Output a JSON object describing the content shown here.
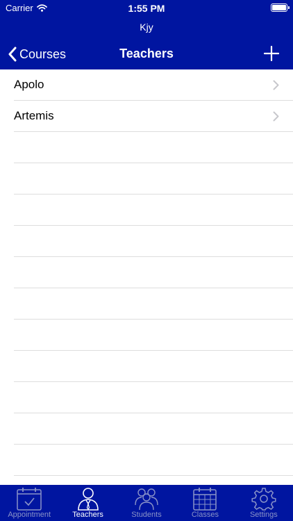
{
  "status": {
    "carrier": "Carrier",
    "time": "1:55 PM"
  },
  "header": {
    "subtitle": "Kjy",
    "back_label": "Courses",
    "title": "Teachers",
    "add_icon": "plus-icon"
  },
  "teachers": [
    {
      "name": "Apolo"
    },
    {
      "name": "Artemis"
    }
  ],
  "tabs": [
    {
      "label": "Appointment",
      "icon": "calendar-check-icon",
      "active": false
    },
    {
      "label": "Teachers",
      "icon": "teacher-icon",
      "active": true
    },
    {
      "label": "Students",
      "icon": "students-icon",
      "active": false
    },
    {
      "label": "Classes",
      "icon": "calendar-grid-icon",
      "active": false
    },
    {
      "label": "Settings",
      "icon": "gear-icon",
      "active": false
    }
  ],
  "colors": {
    "bar": "#0015a0",
    "inactive_tab": "#8a93c8",
    "active_tab": "#ffffff",
    "chevron": "#c7c7cc"
  }
}
